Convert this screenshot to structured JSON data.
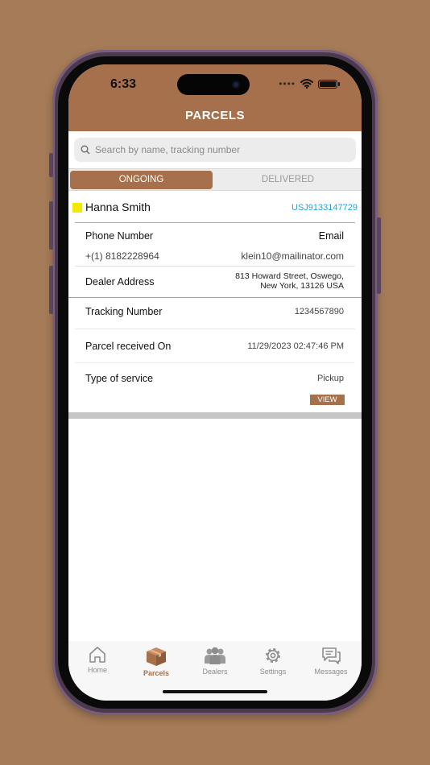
{
  "status": {
    "time": "6:33"
  },
  "header": {
    "title": "PARCELS"
  },
  "search": {
    "placeholder": "Search by name, tracking number"
  },
  "tabs": [
    {
      "label": "ONGOING",
      "active": true
    },
    {
      "label": "DELIVERED",
      "active": false
    }
  ],
  "parcel": {
    "customer_name": "Hanna Smith",
    "tracking_id_link": "USJ9133147729",
    "phone_label": "Phone Number",
    "phone_value": "+(1) 8182228964",
    "email_label": "Email",
    "email_value": "klein10@mailinator.com",
    "dealer_address_label": "Dealer Address",
    "dealer_address_line1": "813 Howard Street, Oswego,",
    "dealer_address_line2": "New York, 13126 USA",
    "tracking_label": "Tracking Number",
    "tracking_value": "1234567890",
    "received_label": "Parcel received On",
    "received_value": "11/29/2023 02:47:46 PM",
    "service_label": "Type of service",
    "service_value": "Pickup",
    "view_label": "VIEW",
    "flag_color": "#f5e800"
  },
  "bottom_nav": [
    {
      "label": "Home",
      "icon": "home-icon",
      "active": false
    },
    {
      "label": "Parcels",
      "icon": "parcel-box-icon",
      "active": true
    },
    {
      "label": "Dealers",
      "icon": "people-icon",
      "active": false
    },
    {
      "label": "Settings",
      "icon": "gear-icon",
      "active": false
    },
    {
      "label": "Messages",
      "icon": "messages-icon",
      "active": false
    }
  ],
  "colors": {
    "brand": "#a5704b",
    "background": "#a57b58",
    "link": "#27a3d8"
  }
}
